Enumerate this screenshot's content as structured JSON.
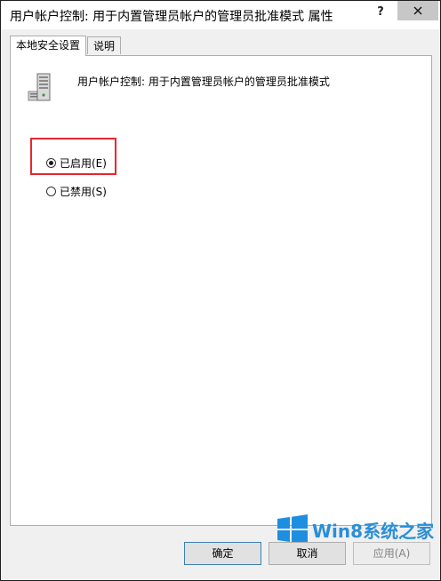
{
  "window": {
    "title": "用户帐户控制: 用于内置管理员帐户的管理员批准模式 属性",
    "help_label": "?",
    "close_icon": "close-icon"
  },
  "tabs": [
    {
      "label": "本地安全设置",
      "active": true
    },
    {
      "label": "说明",
      "active": false
    }
  ],
  "policy": {
    "icon": "server-policy-icon",
    "name": "用户帐户控制: 用于内置管理员帐户的管理员批准模式"
  },
  "options": [
    {
      "label": "已启用(E)",
      "checked": true
    },
    {
      "label": "已禁用(S)",
      "checked": false
    }
  ],
  "highlight_color": "#e8262e",
  "buttons": {
    "ok": "确定",
    "cancel": "取消",
    "apply": "应用(A)"
  },
  "watermark": {
    "text": "Win8系统之家",
    "logo": "windows-logo-icon",
    "color": "#2a8fd6"
  }
}
